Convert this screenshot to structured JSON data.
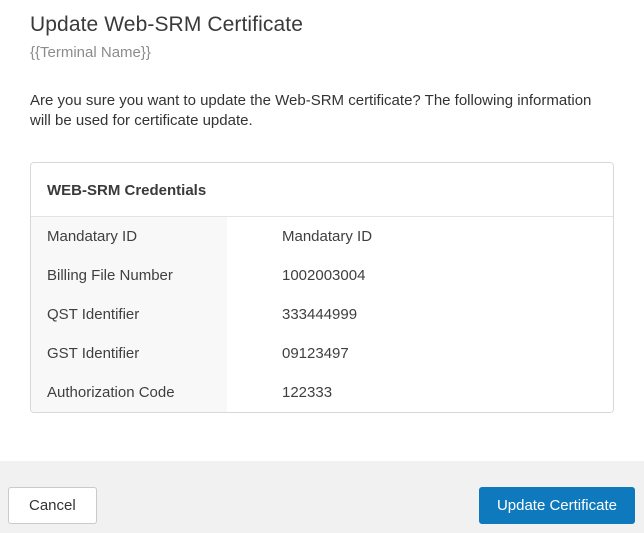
{
  "dialog": {
    "title": "Update Web-SRM Certificate",
    "subtitle": "{{Terminal Name}}",
    "message": "Are you sure you want to update the Web-SRM certificate?  The following information will be used for certificate update."
  },
  "credentials_card": {
    "header": "WEB-SRM Credentials",
    "rows": [
      {
        "label": "Mandatary ID",
        "value": "Mandatary ID"
      },
      {
        "label": "Billing File Number",
        "value": "1002003004"
      },
      {
        "label": "QST Identifier",
        "value": "333444999"
      },
      {
        "label": "GST Identifier",
        "value": "09123497"
      },
      {
        "label": "Authorization Code",
        "value": "122333"
      }
    ]
  },
  "footer": {
    "cancel_label": "Cancel",
    "update_label": "Update Certificate"
  },
  "colors": {
    "primary_button": "#0e79bd",
    "footer_background": "#f1f1f1",
    "label_column_background": "#f8f8f8",
    "card_border": "#d8d8d8",
    "subtitle_text": "#8c8c8c"
  }
}
